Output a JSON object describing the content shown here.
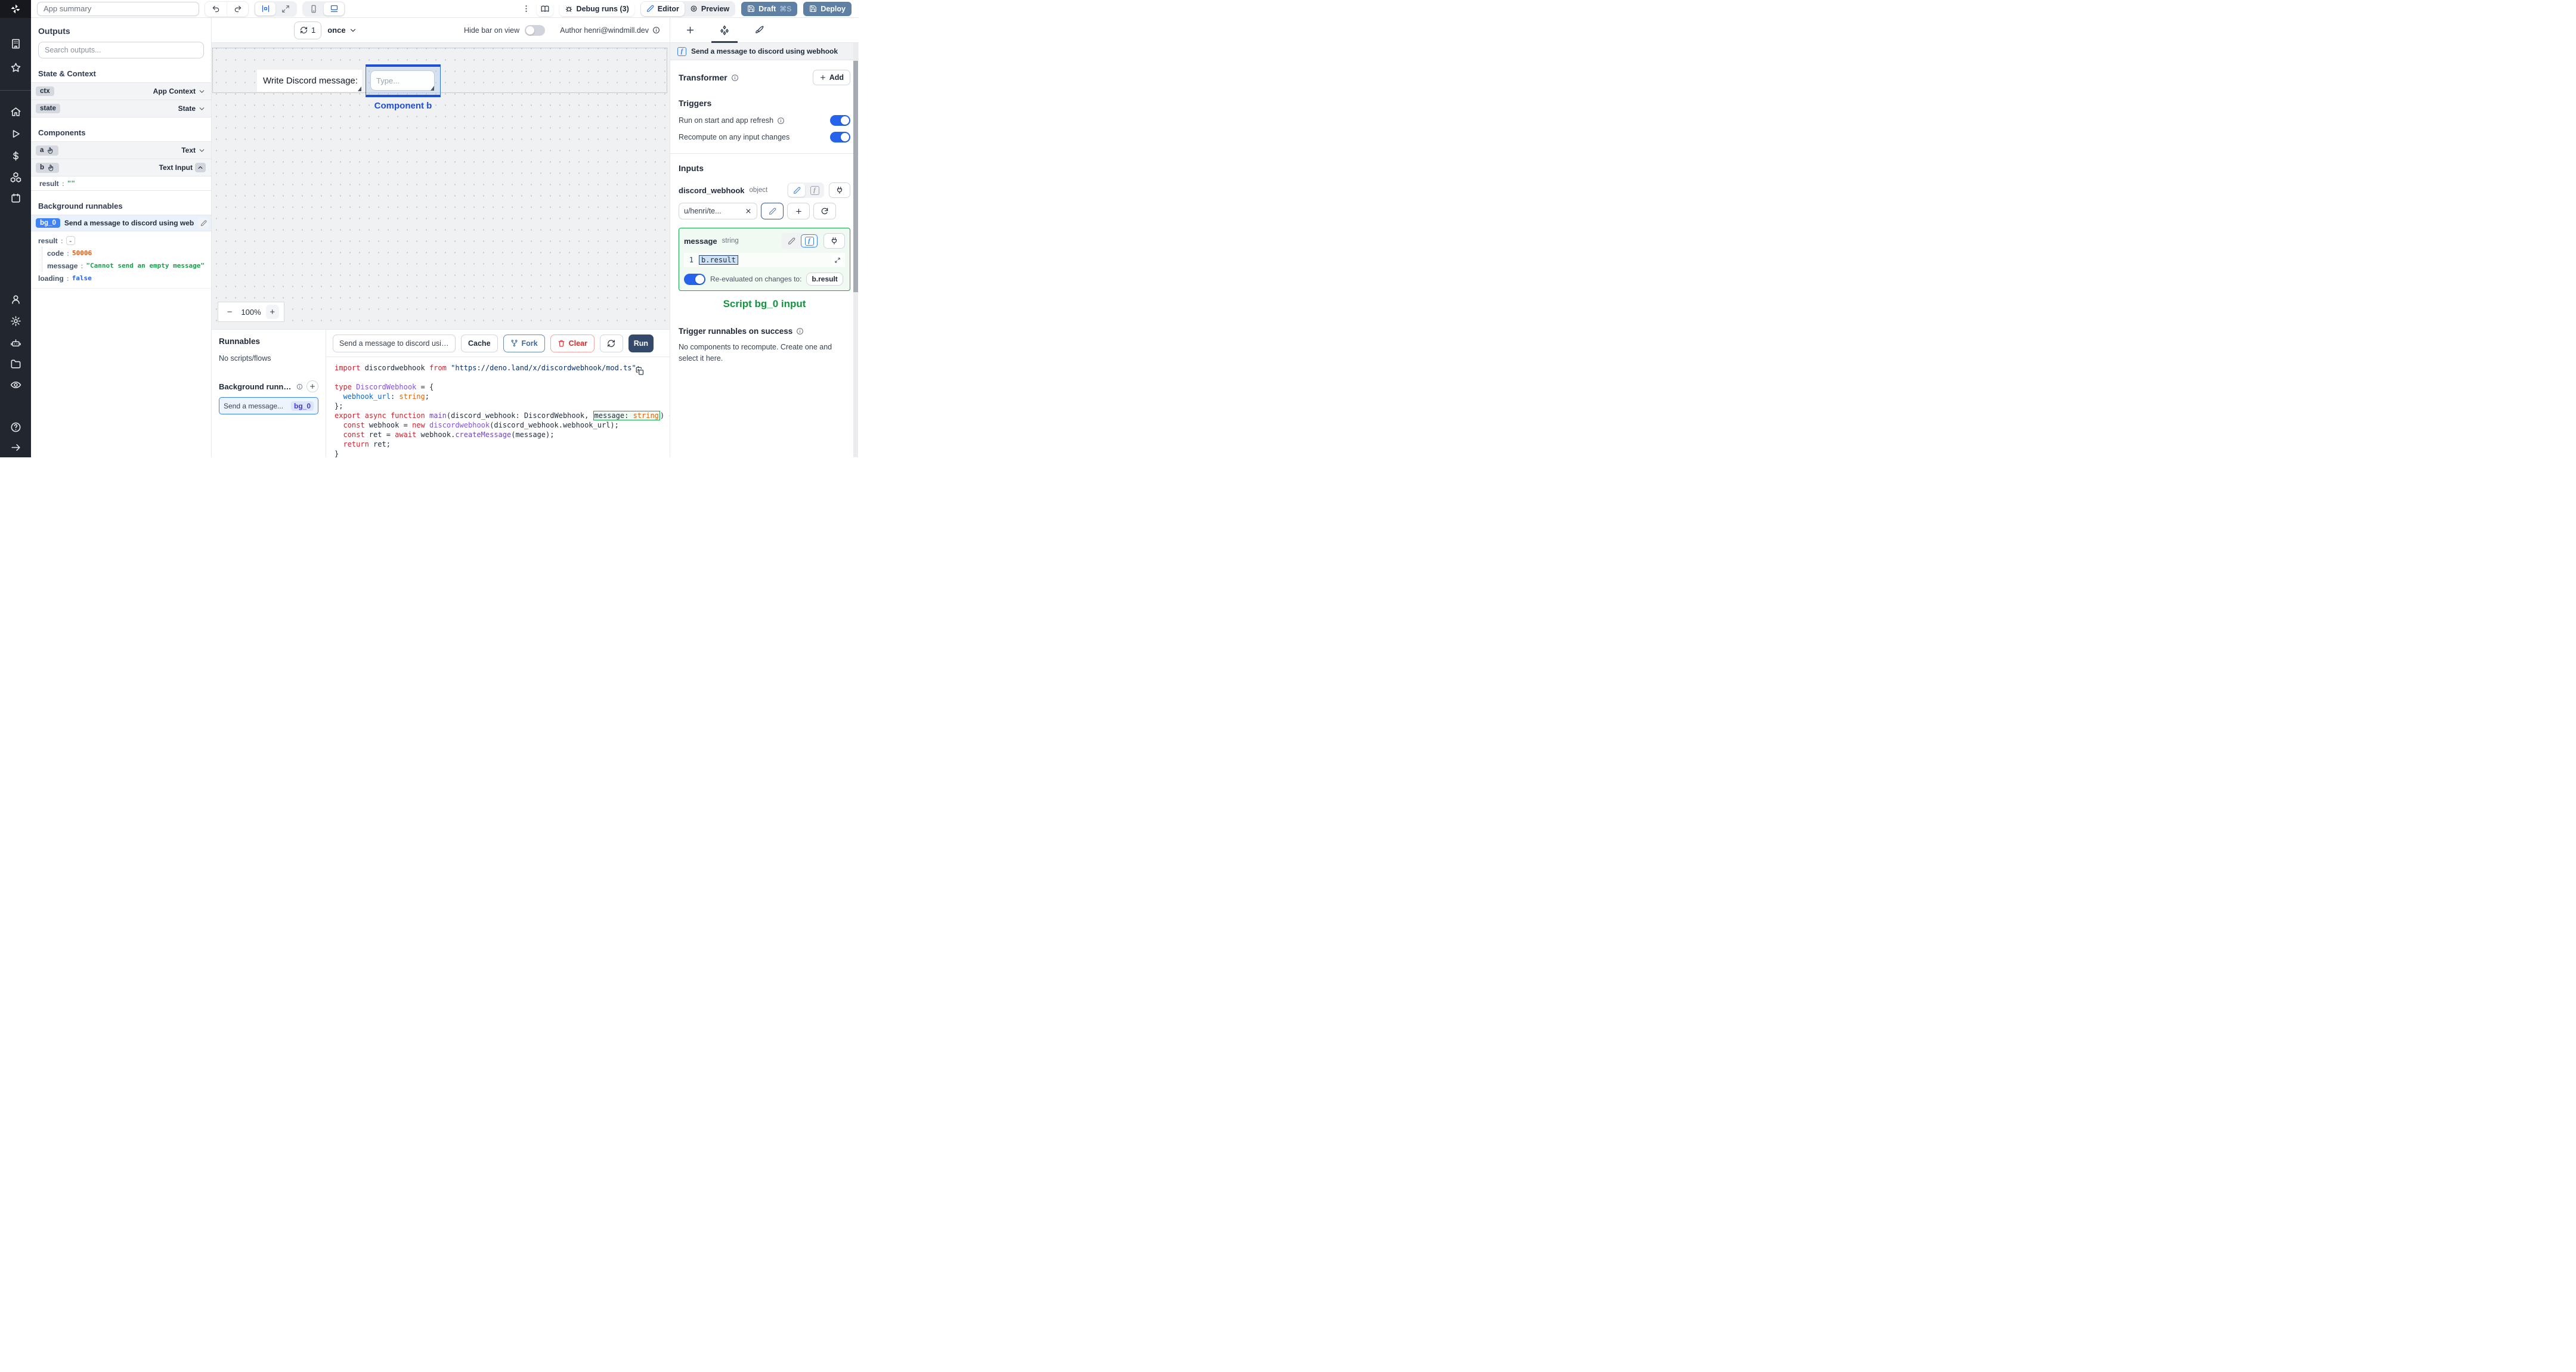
{
  "topbar": {
    "app_summary": "App summary",
    "debug_runs_label": "Debug runs (3)",
    "editor_label": "Editor",
    "preview_label": "Preview",
    "draft_label": "Draft",
    "draft_shortcut": "⌘S",
    "deploy_label": "Deploy"
  },
  "canvas_toolbar": {
    "refresh_count": "1",
    "interval_selected": "once",
    "hide_bar_label": "Hide bar on view",
    "author_label": "Author henri@windmill.dev"
  },
  "canvas": {
    "text_component_value": "Write Discord message:",
    "input_placeholder": "Type...",
    "selection_label": "Component b",
    "zoom_minus": "−",
    "zoom_level": "100%",
    "zoom_plus": "+"
  },
  "outputs_panel": {
    "title": "Outputs",
    "search_placeholder": "Search outputs...",
    "state_context_title": "State & Context",
    "ctx": {
      "key": "ctx",
      "type": "App Context"
    },
    "state": {
      "key": "state",
      "type": "State"
    },
    "components_title": "Components",
    "component_a": {
      "key": "a",
      "type": "Text"
    },
    "component_b": {
      "key": "b",
      "type": "Text Input"
    },
    "b_result": {
      "key": "result",
      "value": "\"\""
    },
    "background_title": "Background runnables",
    "bg0": {
      "badge": "bg_0",
      "title": "Send a message to discord using webhook"
    },
    "bg0_outputs": {
      "result_key": "result",
      "result_collapse": "-",
      "code_key": "code",
      "code_value": "50006",
      "message_key": "message",
      "message_value": "\"Cannot send an empty message\"",
      "loading_key": "loading",
      "loading_value": "false"
    }
  },
  "runnables_panel": {
    "title": "Runnables",
    "empty": "No scripts/flows",
    "background_title": "Background runnables",
    "item_label": "Send a message...",
    "item_badge": "bg_0"
  },
  "script_panel": {
    "tab_title": "Send a message to discord using",
    "cache_label": "Cache",
    "fork_label": "Fork",
    "clear_label": "Clear",
    "run_label": "Run"
  },
  "code": {
    "lines": [
      [
        {
          "t": "import",
          "c": "k"
        },
        {
          "t": " discordwebhook ",
          "c": "d"
        },
        {
          "t": "from",
          "c": "k"
        },
        {
          "t": " ",
          "c": "d"
        },
        {
          "t": "\"https://deno.land/x/discordwebhook/mod.ts\"",
          "c": "s"
        },
        {
          "t": ";",
          "c": "d"
        }
      ],
      [],
      [
        {
          "t": "type",
          "c": "k"
        },
        {
          "t": " ",
          "c": "d"
        },
        {
          "t": "DiscordWebhook",
          "c": "t"
        },
        {
          "t": " = {",
          "c": "d"
        }
      ],
      [
        {
          "t": "  ",
          "c": "d"
        },
        {
          "t": "webhook_url",
          "c": "p"
        },
        {
          "t": ": ",
          "c": "d"
        },
        {
          "t": "string",
          "c": "ty"
        },
        {
          "t": ";",
          "c": "d"
        }
      ],
      [
        {
          "t": "};",
          "c": "d"
        }
      ],
      [
        {
          "t": "export",
          "c": "k"
        },
        {
          "t": " ",
          "c": "d"
        },
        {
          "t": "async",
          "c": "k"
        },
        {
          "t": " ",
          "c": "d"
        },
        {
          "t": "function",
          "c": "k"
        },
        {
          "t": " ",
          "c": "d"
        },
        {
          "t": "main",
          "c": "fn"
        },
        {
          "t": "(discord_webhook: DiscordWebhook, ",
          "c": "d"
        },
        {
          "g": [
            {
              "t": "message",
              "c": "d"
            },
            {
              "t": ": ",
              "c": "d"
            },
            {
              "t": "string",
              "c": "ty"
            }
          ]
        },
        {
          "t": ") {",
          "c": "d"
        }
      ],
      [
        {
          "t": "  ",
          "c": "d"
        },
        {
          "t": "const",
          "c": "k"
        },
        {
          "t": " webhook = ",
          "c": "d"
        },
        {
          "t": "new",
          "c": "k"
        },
        {
          "t": " ",
          "c": "d"
        },
        {
          "t": "discordwebhook",
          "c": "t"
        },
        {
          "t": "(discord_webhook.webhook_url);",
          "c": "d"
        }
      ],
      [
        {
          "t": "  ",
          "c": "d"
        },
        {
          "t": "const",
          "c": "k"
        },
        {
          "t": " ret = ",
          "c": "d"
        },
        {
          "t": "await",
          "c": "k"
        },
        {
          "t": " webhook.",
          "c": "d"
        },
        {
          "t": "createMessage",
          "c": "fn"
        },
        {
          "t": "(message);",
          "c": "d"
        }
      ],
      [
        {
          "t": "  ",
          "c": "d"
        },
        {
          "t": "return",
          "c": "k"
        },
        {
          "t": " ret;",
          "c": "d"
        }
      ],
      [
        {
          "t": "}",
          "c": "d"
        }
      ]
    ]
  },
  "right_panel": {
    "header_title": "Send a message to discord using webhook",
    "transformer_label": "Transformer",
    "add_label": "Add",
    "triggers_title": "Triggers",
    "run_on_start_label": "Run on start and app refresh",
    "recompute_label": "Recompute on any input changes",
    "inputs_title": "Inputs",
    "webhook_input": {
      "name": "discord_webhook",
      "type": "object",
      "value": "u/henri/te..."
    },
    "message_input": {
      "name": "message",
      "type": "string",
      "line_number": "1",
      "expression": "b.result",
      "reeval_label": "Re-evaluated on changes to:",
      "reeval_target": "b.result"
    },
    "annotation": "Script bg_0 input",
    "trigger_runnables_title": "Trigger runnables on success",
    "trigger_runnables_empty": "No components to recompute. Create one and select it here."
  },
  "colors": {
    "accent_blue": "#2563eb",
    "selection_blue": "#1d4ed8",
    "success_green": "#16a34a",
    "error_red": "#dc2626",
    "json_number_orange": "#e8590c",
    "json_string_green": "#16a34a",
    "json_bool_blue": "#2563eb",
    "steel_button": "#5e80a5",
    "run_button": "#35496b",
    "bg0_badge_blue": "#3f83f8"
  }
}
